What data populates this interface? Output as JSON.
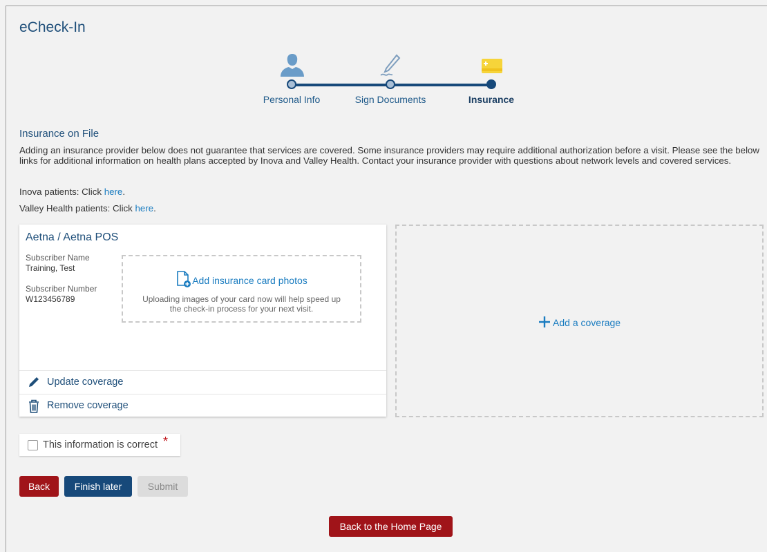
{
  "app": {
    "title": "eCheck-In"
  },
  "stepper": {
    "steps": [
      {
        "label": "Personal Info",
        "icon": "person-icon",
        "state": "complete"
      },
      {
        "label": "Sign Documents",
        "icon": "signature-pen-icon",
        "state": "complete"
      },
      {
        "label": "Insurance",
        "icon": "insurance-card-icon",
        "state": "current"
      }
    ]
  },
  "insurance": {
    "section_title": "Insurance on File",
    "notice": "Adding an insurance provider below does not guarantee that services are covered. Some insurance providers may require additional authorization before a visit. Please see the below links for additional information on health plans accepted by Inova and Valley Health. Contact your insurance provider with questions about network levels and covered services.",
    "inova_prefix": "Inova patients: Click ",
    "valley_prefix": "Valley Health patients: Click ",
    "link_text": "here",
    "period": "."
  },
  "coverage": {
    "name": "Aetna / Aetna POS",
    "subscriber_name_label": "Subscriber Name",
    "subscriber_name": "Training, Test",
    "subscriber_number_label": "Subscriber Number",
    "subscriber_number": "W123456789",
    "add_photos": "Add insurance card photos",
    "photo_help": "Uploading images of your card now will help speed up the check-in process for your next visit.",
    "update_label": "Update coverage",
    "remove_label": "Remove coverage"
  },
  "add_coverage": {
    "label": "Add a coverage"
  },
  "confirm": {
    "label": "This information is correct",
    "required_mark": "*",
    "checked": false
  },
  "buttons": {
    "back": "Back",
    "finish_later": "Finish later",
    "submit": "Submit",
    "home": "Back to the Home Page"
  },
  "colors": {
    "primary": "#17497a",
    "danger": "#a01419",
    "link": "#1a7cc0"
  }
}
